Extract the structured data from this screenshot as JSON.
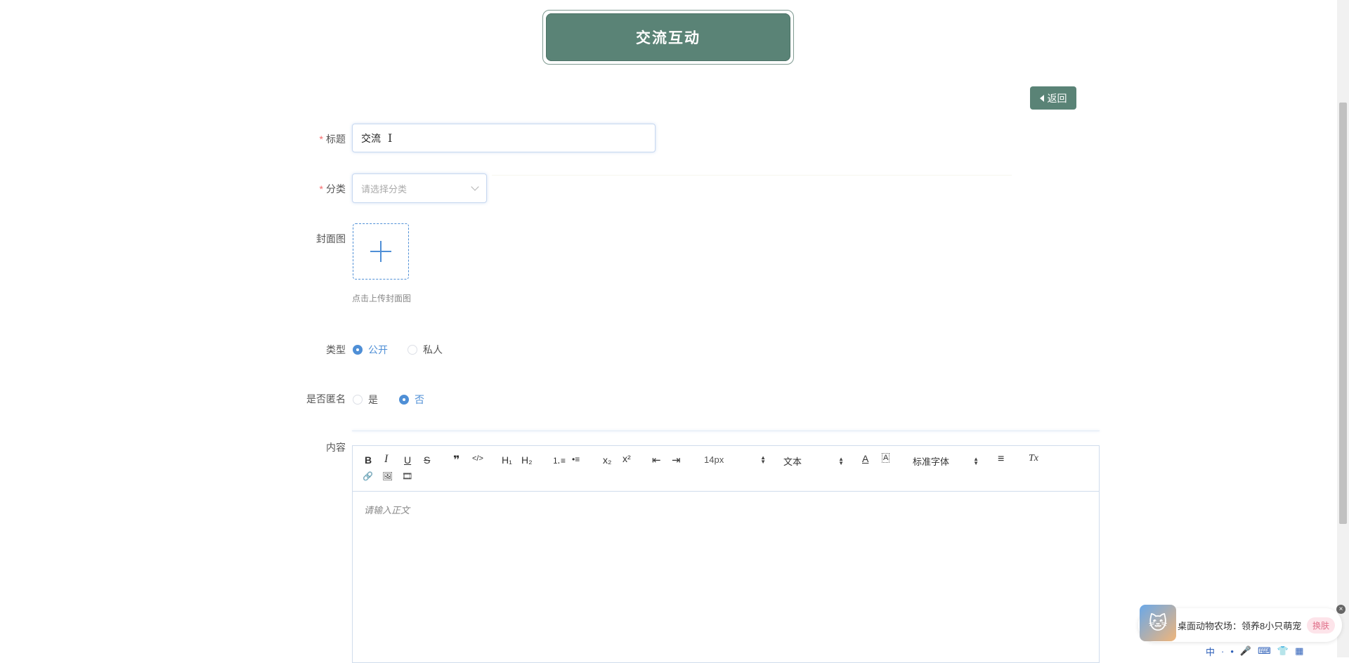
{
  "header": {
    "title": "交流互动"
  },
  "back_button": {
    "label": "返回"
  },
  "form": {
    "title_field": {
      "label": "标题",
      "required_mark": "*",
      "value": "交流"
    },
    "category_field": {
      "label": "分类",
      "required_mark": "*",
      "placeholder": "请选择分类"
    },
    "cover_field": {
      "label": "封面图",
      "hint": "点击上传封面图"
    },
    "type_field": {
      "label": "类型",
      "options": [
        {
          "label": "公开",
          "selected": true
        },
        {
          "label": "私人",
          "selected": false
        }
      ]
    },
    "anonymous_field": {
      "label": "是否匿名",
      "options": [
        {
          "label": "是",
          "selected": false
        },
        {
          "label": "否",
          "selected": true
        }
      ]
    },
    "content_field": {
      "label": "内容"
    }
  },
  "editor": {
    "toolbar": {
      "bold": "B",
      "italic": "I",
      "underline": "U",
      "strike": "S",
      "quote": "❞",
      "code": "</>",
      "h1": "H₁",
      "h2": "H₂",
      "ordered_list": "⒈≡",
      "bullet_list": "•≡",
      "subscript": "x₂",
      "superscript": "x²",
      "outdent": "⇤",
      "indent": "⇥",
      "font_size": "14px",
      "paragraph": "文本",
      "font_color": "A",
      "background_color": "A",
      "font_family": "标准字体",
      "align": "≡",
      "clean": "Tx",
      "link": "🔗",
      "image": "🖼",
      "video": "🎞"
    },
    "placeholder": "请输入正文"
  },
  "widget": {
    "text": "桌面动物农场：领养8小只萌宠",
    "skin_button": "换肤",
    "close": "×"
  },
  "tray": {
    "ime": "中",
    "items": [
      "·",
      "•",
      "🎤",
      "⌨",
      "👕",
      "▦"
    ]
  },
  "colors": {
    "brand": "#5a8376",
    "accent": "#4f8fd6",
    "required": "#f56c6c"
  }
}
